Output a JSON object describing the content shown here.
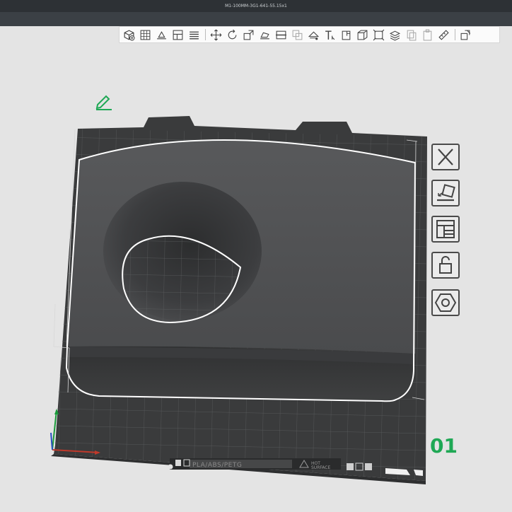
{
  "window": {
    "title": "M1-100MM-3G1-641-55.15x1"
  },
  "toolbar": {
    "group1": [
      "add-icon",
      "grid-arrange-icon",
      "orient-icon",
      "layout-icon",
      "layers-icon"
    ],
    "group2": [
      "move-icon",
      "rotate-icon",
      "scale-icon",
      "lay-flat-icon",
      "cut-icon",
      "boolean-icon",
      "support-paint-icon",
      "text-icon",
      "measure-icon",
      "cube-icon",
      "bounding-box-icon",
      "stack-icon",
      "copy-icon",
      "paste-icon",
      "ruler-icon"
    ],
    "group3": [
      "assembly-icon"
    ]
  },
  "side_panel": [
    "close-icon",
    "auto-orient-icon",
    "arrange-icon",
    "lock-icon",
    "hex-nut-icon"
  ],
  "plate": {
    "label": "01",
    "filament": "PLA/ABS/PETG",
    "surface_line1": "HOT",
    "surface_line2": "SURFACE"
  },
  "colors": {
    "background": "#e4e4e4",
    "plate": "#3a3b3c",
    "model": "#4b4d4f",
    "selection": "#ffffff",
    "plate_label": "#1fa855",
    "edit_icon": "#1fa855"
  }
}
